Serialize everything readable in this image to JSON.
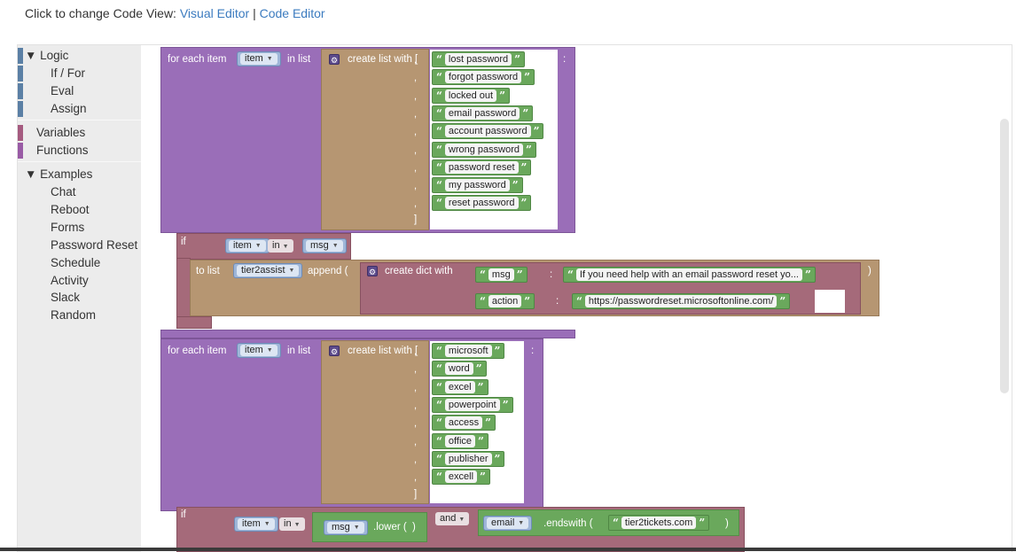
{
  "header": {
    "prefix": "Click to change Code View:",
    "visual_link": "Visual Editor",
    "sep": "|",
    "code_link": "Code Editor"
  },
  "toolbox": {
    "categories": [
      {
        "label": "▼ Logic",
        "color": "#5b80a5"
      },
      {
        "label": "If / For",
        "color": "#5b80a5"
      },
      {
        "label": "Eval",
        "color": "#5b80a5"
      },
      {
        "label": "Assign",
        "color": "#5b80a5"
      },
      {
        "label": "Variables",
        "color": "#a55b80"
      },
      {
        "label": "Functions",
        "color": "#995ba5"
      },
      {
        "label": "▼ Examples",
        "color": ""
      },
      {
        "label": "Chat"
      },
      {
        "label": "Reboot"
      },
      {
        "label": "Forms"
      },
      {
        "label": "Password Reset"
      },
      {
        "label": "Schedule"
      },
      {
        "label": "Activity"
      },
      {
        "label": "Slack"
      },
      {
        "label": "Random"
      }
    ]
  },
  "blocks": {
    "foreach1": {
      "for_each": "for each item",
      "var": "item",
      "in_list": "in list",
      "create": "create list with [",
      "close": "]",
      "colon": ":",
      "strings": [
        "lost password",
        "forgot password",
        "locked out",
        "email password",
        "account password",
        "wrong password",
        "password reset",
        "my password",
        "reset password"
      ]
    },
    "if1": {
      "if": "if",
      "var": "item",
      "op": "in",
      "rhs": "msg",
      "to_list": "to list",
      "list_var": "tier2assist",
      "append": "append (",
      "create_dict": "create dict with",
      "close_paren": ")",
      "colon": ":",
      "k1": "msg",
      "v1": "If you need help with an email password reset yo...",
      "k2": "action",
      "v2": "https://passwordreset.microsoftonline.com/"
    },
    "foreach2": {
      "for_each": "for each item",
      "var": "item",
      "in_list": "in list",
      "create": "create list with [",
      "close": "]",
      "colon": ":",
      "strings": [
        "microsoft",
        "word",
        "excel",
        "powerpoint",
        "access",
        "office",
        "publisher",
        "excell"
      ]
    },
    "if2": {
      "if": "if",
      "var": "item",
      "op": "in",
      "msg": "msg",
      "lower": ".lower (",
      "lower_close": ")",
      "and": "and",
      "email": "email",
      "endswith": ".endswith (",
      "domain": "tier2tickets.com",
      "end_close": ")"
    }
  },
  "colors": {
    "loop": "#9a6eb8",
    "list": "#b69672",
    "text": "#6aa85c",
    "if": "#a56a7a",
    "variable": "#9fb6d8"
  }
}
